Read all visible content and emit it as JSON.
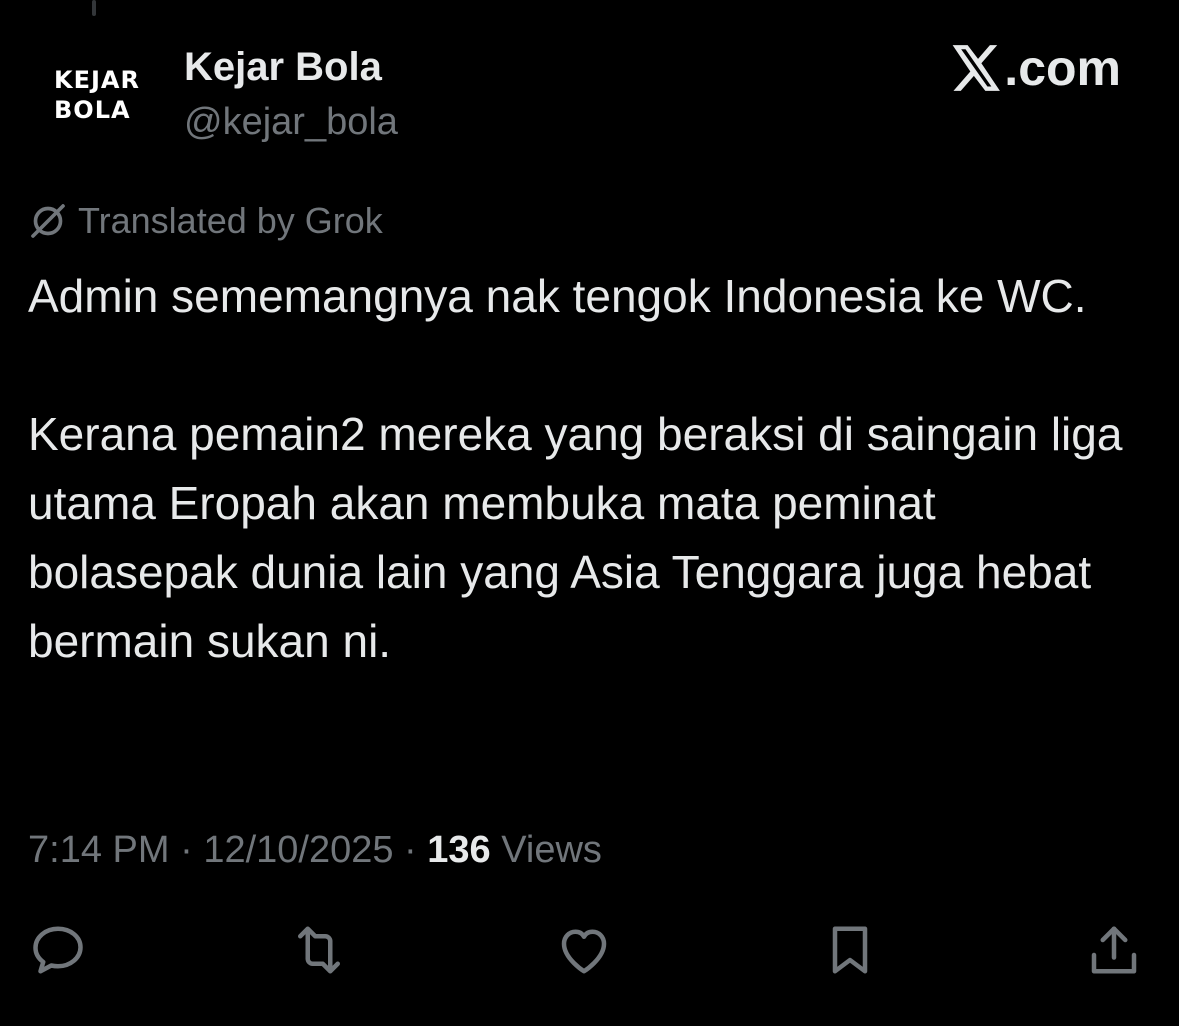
{
  "tweet": {
    "author": {
      "avatar_text_line1": "KEJAR",
      "avatar_text_line2": "BOLA",
      "display_name": "Kejar Bola",
      "handle": "@kejar_bola"
    },
    "brand": {
      "text": ".com",
      "logo_icon": "x-logo-icon"
    },
    "translation_notice": {
      "icon": "grok-icon",
      "text": "Translated by Grok"
    },
    "paragraphs": [
      "Admin sememangnya nak tengok Indonesia ke WC.",
      "Kerana pemain2 mereka yang beraksi di saingain liga utama Eropah akan membuka mata peminat bolasepak dunia lain yang Asia Tenggara juga hebat bermain sukan ni."
    ],
    "meta": {
      "time": "7:14 PM",
      "separator": " · ",
      "date": "12/10/2025",
      "views_count": "136",
      "views_label": " Views"
    },
    "actions": [
      {
        "name": "reply",
        "icon": "reply-icon"
      },
      {
        "name": "repost",
        "icon": "repost-icon"
      },
      {
        "name": "like",
        "icon": "heart-icon"
      },
      {
        "name": "bookmark",
        "icon": "bookmark-icon"
      },
      {
        "name": "share",
        "icon": "share-icon"
      }
    ]
  },
  "colors": {
    "background": "#000000",
    "primary_text": "#e7e9ea",
    "secondary_text": "#71767b"
  }
}
